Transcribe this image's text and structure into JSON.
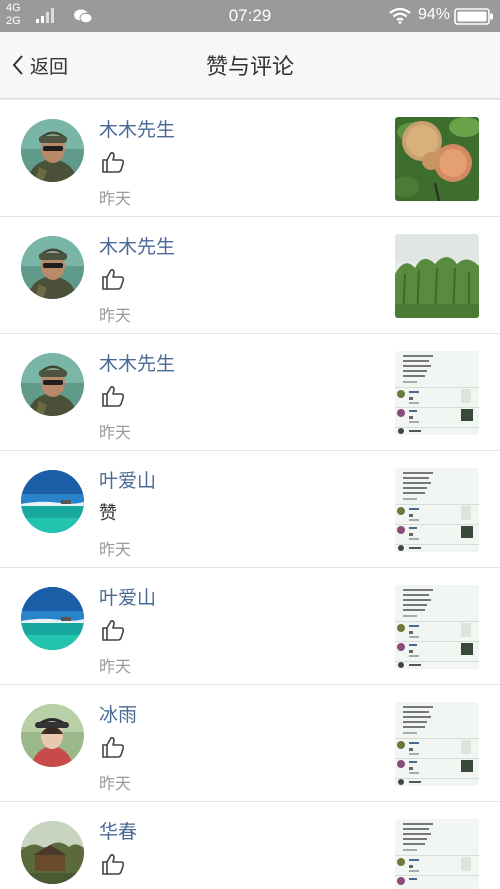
{
  "status_bar": {
    "network_4g": "4G",
    "network_2g": "2G",
    "time": "07:29",
    "battery": "94%",
    "icons": [
      "signal-icon",
      "wechat-icon",
      "wifi-icon",
      "battery-icon"
    ]
  },
  "nav": {
    "back_label": "返回",
    "title": "赞与评论"
  },
  "items": [
    {
      "name": "木木先生",
      "action": "like",
      "time": "昨天",
      "avatar": "soldier",
      "thumb": "peaches"
    },
    {
      "name": "木木先生",
      "action": "like",
      "time": "昨天",
      "avatar": "soldier",
      "thumb": "willows"
    },
    {
      "name": "木木先生",
      "action": "like",
      "time": "昨天",
      "avatar": "soldier",
      "thumb": "screenshot"
    },
    {
      "name": "叶爱山",
      "action": "text",
      "text": "赞",
      "time": "昨天",
      "avatar": "sea",
      "thumb": "screenshot"
    },
    {
      "name": "叶爱山",
      "action": "like",
      "time": "昨天",
      "avatar": "sea",
      "thumb": "screenshot"
    },
    {
      "name": "冰雨",
      "action": "like",
      "time": "昨天",
      "avatar": "woman",
      "thumb": "screenshot"
    },
    {
      "name": "华春",
      "action": "like",
      "time": "",
      "avatar": "landscape",
      "thumb": "screenshot"
    }
  ],
  "colors": {
    "name": "#4a6a96",
    "status_bar": "#9a9a9a",
    "nav_bg": "#f7f7f7",
    "divider": "#dfe8df",
    "time": "#9a9a9a"
  }
}
